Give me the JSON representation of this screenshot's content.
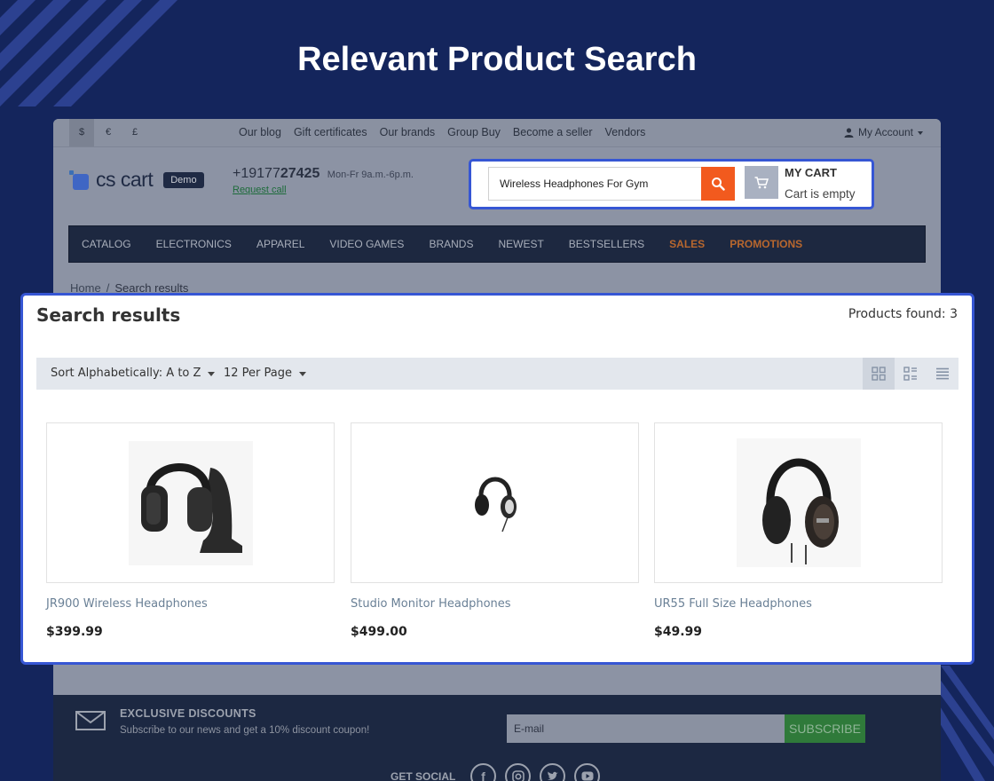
{
  "hero": {
    "title": "Relevant Product Search"
  },
  "topbar": {
    "currencies": [
      "$",
      "€",
      "£"
    ],
    "links": [
      "Our blog",
      "Gift certificates",
      "Our brands",
      "Group Buy",
      "Become a seller",
      "Vendors"
    ],
    "account_label": "My Account"
  },
  "header": {
    "logo_text": "cs cart",
    "demo_badge": "Demo",
    "phone_prefix": "+19177",
    "phone_bold": "27425",
    "phone_hours": "Mon-Fr 9a.m.-6p.m.",
    "request_call": "Request call"
  },
  "nav": {
    "items": [
      "CATALOG",
      "ELECTRONICS",
      "APPAREL",
      "VIDEO GAMES",
      "BRANDS",
      "NEWEST",
      "BESTSELLERS",
      "SALES",
      "PROMOTIONS"
    ]
  },
  "breadcrumb": {
    "home": "Home",
    "separator": "/",
    "current": "Search results"
  },
  "search": {
    "value": "Wireless Headphones For Gym"
  },
  "cart": {
    "title": "MY CART",
    "status": "Cart is empty"
  },
  "results": {
    "title": "Search results",
    "found": "Products found: 3",
    "sort_label": "Sort Alphabetically: A to Z",
    "per_page_label": "12 Per Page",
    "products": [
      {
        "name": "JR900 Wireless Headphones",
        "price": "$399.99"
      },
      {
        "name": "Studio Monitor Headphones",
        "price": "$499.00"
      },
      {
        "name": "UR55 Full Size Headphones",
        "price": "$49.99"
      }
    ]
  },
  "footer": {
    "discount_title": "EXCLUSIVE DISCOUNTS",
    "discount_sub": "Subscribe to our news and get a 10% discount coupon!",
    "email_placeholder": "E-mail",
    "subscribe_label": "SUBSCRIBE",
    "get_social": "GET SOCIAL",
    "social_icons": [
      "facebook-icon",
      "instagram-icon",
      "twitter-icon",
      "youtube-icon"
    ]
  },
  "colors": {
    "background": "#14255c",
    "accent_blue": "#3656d4",
    "search_button": "#f25a1e",
    "nav_orange": "#b8672e"
  }
}
